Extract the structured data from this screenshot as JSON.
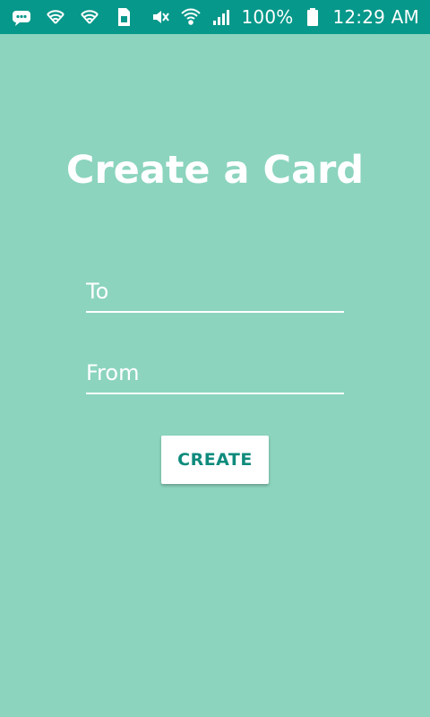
{
  "status_bar": {
    "battery": "100%",
    "time": "12:29 AM",
    "icons_left": [
      "chat-icon",
      "shield-icon",
      "shield-icon",
      "sim-icon"
    ],
    "icons_right": [
      "vibrate-icon",
      "wifi-icon",
      "signal-icon",
      "battery-icon"
    ]
  },
  "colors": {
    "background": "#8cd4be",
    "status_bar": "#06988a",
    "accent_text": "#0f8b7c",
    "text": "#ffffff"
  },
  "main": {
    "title": "Create a Card",
    "to_placeholder": "To",
    "from_placeholder": "From",
    "create_label": "CREATE"
  }
}
